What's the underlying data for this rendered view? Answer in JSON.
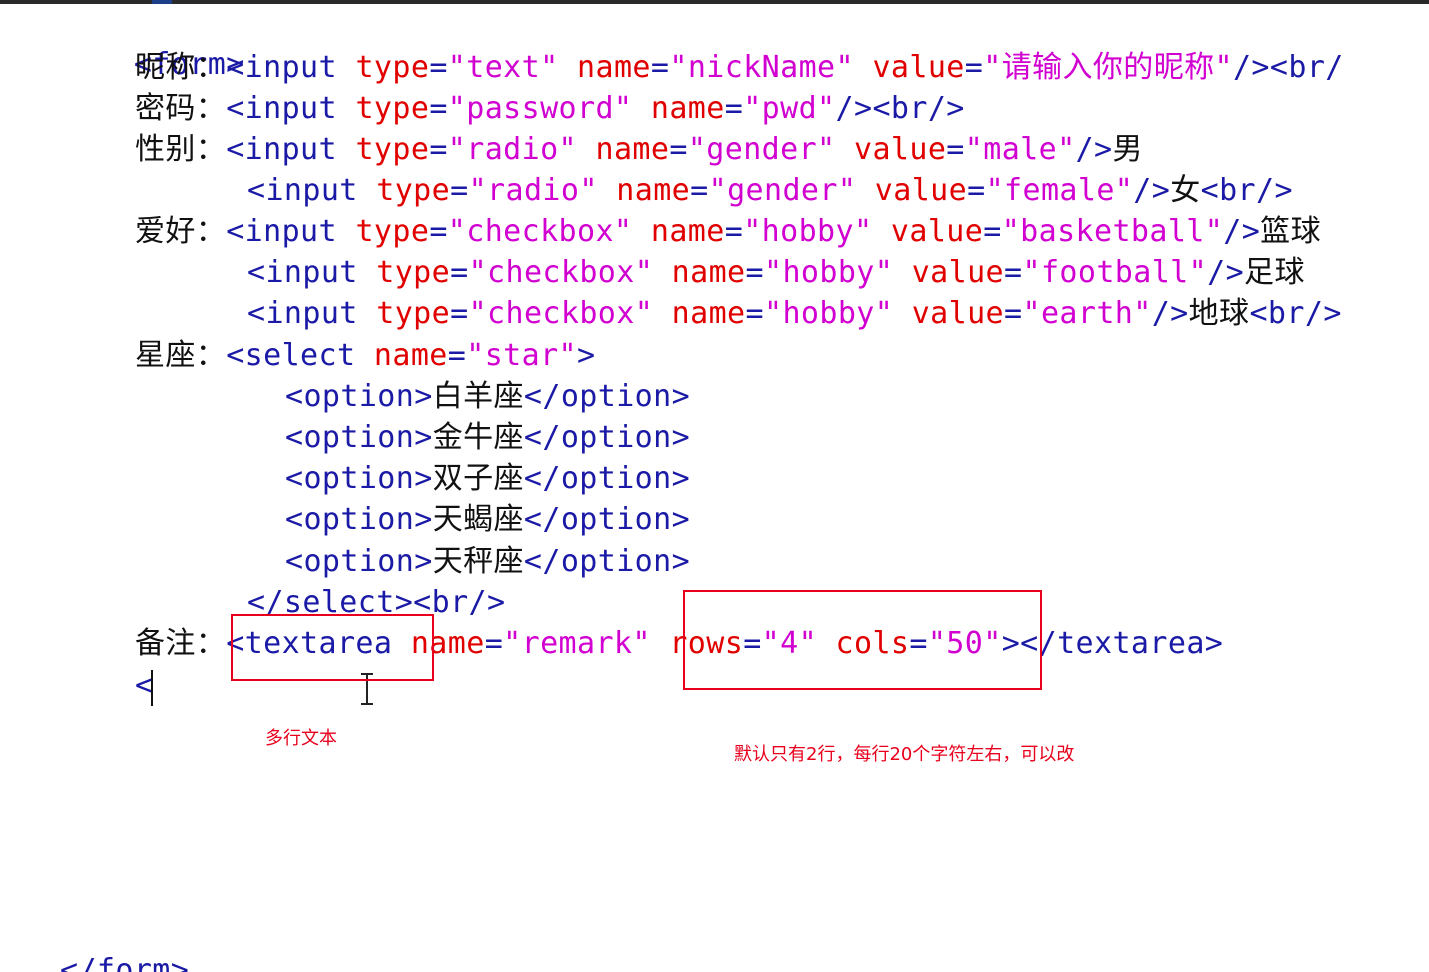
{
  "code": {
    "form_open": "<form>",
    "l_nick": {
      "label": "昵称：",
      "tag": "<input",
      "a1": "type",
      "v1": "\"text\"",
      "a2": "name",
      "v2": "\"nickName\"",
      "a3": "value",
      "v3": "\"请输入你的昵称\"",
      "end": "/><br/"
    },
    "l_pwd": {
      "label": "密码：",
      "tag": "<input",
      "a1": "type",
      "v1": "\"password\"",
      "a2": "name",
      "v2": "\"pwd\"",
      "end": "/><br/>"
    },
    "l_gender1": {
      "label": "性别：",
      "tag": "<input",
      "a1": "type",
      "v1": "\"radio\"",
      "a2": "name",
      "v2": "\"gender\"",
      "a3": "value",
      "v3": "\"male\"",
      "end": "/>",
      "text": "男"
    },
    "l_gender2": {
      "tag": "<input",
      "a1": "type",
      "v1": "\"radio\"",
      "a2": "name",
      "v2": "\"gender\"",
      "a3": "value",
      "v3": "\"female\"",
      "end": "/>",
      "text": "女",
      "end2": "<br/>"
    },
    "l_hobby1": {
      "label": "爱好：",
      "tag": "<input",
      "a1": "type",
      "v1": "\"checkbox\"",
      "a2": "name",
      "v2": "\"hobby\"",
      "a3": "value",
      "v3": "\"basketball\"",
      "end": "/>",
      "text": "篮球"
    },
    "l_hobby2": {
      "tag": "<input",
      "a1": "type",
      "v1": "\"checkbox\"",
      "a2": "name",
      "v2": "\"hobby\"",
      "a3": "value",
      "v3": "\"football\"",
      "end": "/>",
      "text": "足球"
    },
    "l_hobby3": {
      "tag": "<input",
      "a1": "type",
      "v1": "\"checkbox\"",
      "a2": "name",
      "v2": "\"hobby\"",
      "a3": "value",
      "v3": "\"earth\"",
      "end": "/>",
      "text": "地球",
      "end2": "<br/>"
    },
    "l_star": {
      "label": "星座：",
      "tag": "<select",
      "a1": "name",
      "v1": "\"star\"",
      "end": ">"
    },
    "options": [
      {
        "open": "<option>",
        "text": "白羊座",
        "close": "</option>"
      },
      {
        "open": "<option>",
        "text": "金牛座",
        "close": "</option>"
      },
      {
        "open": "<option>",
        "text": "双子座",
        "close": "</option>"
      },
      {
        "open": "<option>",
        "text": "天蝎座",
        "close": "</option>"
      },
      {
        "open": "<option>",
        "text": "天秤座",
        "close": "</option>"
      }
    ],
    "select_close": "</select><br/>",
    "l_remark": {
      "label": "备注：",
      "tag": "<textarea",
      "a1": "name",
      "v1": "\"remark\"",
      "a2": "rows",
      "v2": "\"4\"",
      "a3": "cols",
      "v3": "\"50\"",
      "end": "></textarea>"
    },
    "cursor_line": "<",
    "form_close": "</form>"
  },
  "annotations": {
    "multiline": "多行文本",
    "rows_cols_note": "默认只有2行，每行20个字符左右，可以改"
  },
  "colors": {
    "tag": "#1a1aa6",
    "attribute": "#e00000",
    "value": "#d100d1",
    "annotation": "#e8001c"
  }
}
